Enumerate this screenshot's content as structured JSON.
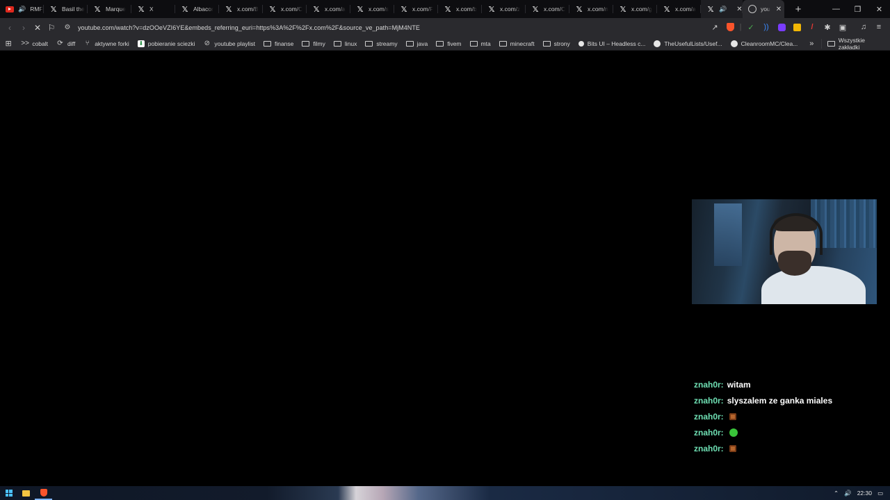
{
  "tabs": [
    {
      "title": "RMF",
      "icon": "youtube-icon",
      "audio": true
    },
    {
      "title": "Basil the",
      "icon": "x-icon"
    },
    {
      "title": "Marque",
      "icon": "x-icon"
    },
    {
      "title": "X",
      "icon": "x-icon"
    },
    {
      "title": "Albacor",
      "icon": "x-icon"
    },
    {
      "title": "x.com/B",
      "icon": "x-icon"
    },
    {
      "title": "x.com/C",
      "icon": "x-icon"
    },
    {
      "title": "x.com/a",
      "icon": "x-icon"
    },
    {
      "title": "x.com/s",
      "icon": "x-icon"
    },
    {
      "title": "x.com/F",
      "icon": "x-icon"
    },
    {
      "title": "x.com/b",
      "icon": "x-icon"
    },
    {
      "title": "x.com/z",
      "icon": "x-icon"
    },
    {
      "title": "x.com/C",
      "icon": "x-icon"
    },
    {
      "title": "x.com/n",
      "icon": "x-icon"
    },
    {
      "title": "x.com/g",
      "icon": "x-icon"
    },
    {
      "title": "x.com/a",
      "icon": "x-icon"
    }
  ],
  "hover_tab": {
    "icon": "x-icon",
    "audio": true
  },
  "active_tab": {
    "title": "you",
    "icon": "loading-globe-icon"
  },
  "address_bar": {
    "url": "youtube.com/watch?v=dzOOeVZI6YE&embeds_referring_euri=https%3A%2F%2Fx.com%2F&source_ve_path=MjM4NTE"
  },
  "bookmarks": [
    {
      "label": "cobalt",
      "icon": "cobalt-icon"
    },
    {
      "label": "diff",
      "icon": "diff-icon"
    },
    {
      "label": "aktywne forki",
      "icon": "fork-icon"
    },
    {
      "label": "pobieranie sciezki",
      "icon": "download-icon"
    },
    {
      "label": "youtube playlist",
      "icon": "playlist-icon"
    },
    {
      "label": "finanse",
      "icon": "folder-icon"
    },
    {
      "label": "filmy",
      "icon": "folder-icon"
    },
    {
      "label": "linux",
      "icon": "folder-icon"
    },
    {
      "label": "streamy",
      "icon": "folder-icon"
    },
    {
      "label": "java",
      "icon": "folder-icon"
    },
    {
      "label": "fivem",
      "icon": "folder-icon"
    },
    {
      "label": "mta",
      "icon": "folder-icon"
    },
    {
      "label": "minecraft",
      "icon": "folder-icon"
    },
    {
      "label": "strony",
      "icon": "folder-icon"
    },
    {
      "label": "Bits UI – Headless c...",
      "icon": "circle-icon"
    },
    {
      "label": "TheUsefulLists/Usef...",
      "icon": "github-icon"
    },
    {
      "label": "CleanroomMC/Clea...",
      "icon": "github-icon"
    }
  ],
  "all_bookmarks_label": "Wszystkie zakładki",
  "chat": [
    {
      "user": "znah0r:",
      "text": "witam",
      "emote": ""
    },
    {
      "user": "znah0r:",
      "text": "slyszalem ze ganka miales",
      "emote": ""
    },
    {
      "user": "znah0r:",
      "text": "",
      "emote": "box"
    },
    {
      "user": "znah0r:",
      "text": "",
      "emote": "green"
    },
    {
      "user": "znah0r:",
      "text": "",
      "emote": "box"
    }
  ],
  "taskbar": {
    "clock": "22:30"
  },
  "colors": {
    "chat_user": "#6fe0b4",
    "chat_text": "#ffffff",
    "chrome_bg": "#2a2a2e",
    "tabstrip_bg": "#0d0d10"
  }
}
